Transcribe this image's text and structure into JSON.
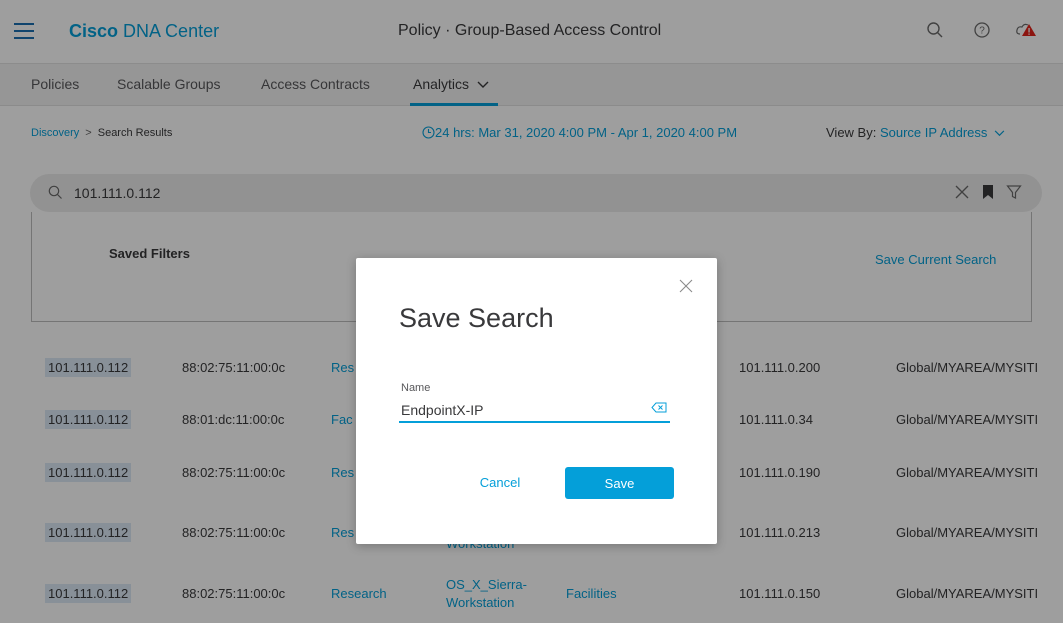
{
  "header": {
    "brand_strong": "Cisco",
    "brand_rest": "DNA Center",
    "title": "Policy · Group-Based Access Control",
    "icons": [
      "search-icon",
      "help-icon",
      "alert-icon"
    ]
  },
  "tabs": [
    {
      "label": "Policies"
    },
    {
      "label": "Scalable Groups"
    },
    {
      "label": "Access Contracts"
    },
    {
      "label": "Analytics"
    }
  ],
  "breadcrumb": {
    "root": "Discovery",
    "separator": ">",
    "current": "Search Results"
  },
  "time_range": "24 hrs:  Mar 31, 2020 4:00 PM - Apr 1, 2020 4:00 PM",
  "view_by": {
    "label": "View By:",
    "value": "Source IP Address"
  },
  "search": {
    "value": "101.111.0.112"
  },
  "filters": {
    "saved_label": "Saved Filters",
    "save_current": "Save Current Search"
  },
  "rows": [
    {
      "ip": "101.111.0.112",
      "mac": "88:02:75:11:00:0c",
      "group": "Res",
      "device": "",
      "dest_group": "",
      "dest_ip": "101.111.0.200",
      "location": "Global/MYAREA/MYSITI"
    },
    {
      "ip": "101.111.0.112",
      "mac": "88:01:dc:11:00:0c",
      "group": "Fac",
      "device": "",
      "dest_group": "",
      "dest_ip": "101.111.0.34",
      "location": "Global/MYAREA/MYSITI"
    },
    {
      "ip": "101.111.0.112",
      "mac": "88:02:75:11:00:0c",
      "group": "Res",
      "device": "",
      "dest_group": "",
      "dest_ip": "101.111.0.190",
      "location": "Global/MYAREA/MYSITI"
    },
    {
      "ip": "101.111.0.112",
      "mac": "88:02:75:11:00:0c",
      "group": "Res",
      "device": "Workstation",
      "dest_group": "",
      "dest_ip": "101.111.0.213",
      "location": "Global/MYAREA/MYSITI"
    },
    {
      "ip": "101.111.0.112",
      "mac": "88:02:75:11:00:0c",
      "group": "Research",
      "device_line1": "OS_X_Sierra-",
      "device_line2": "Workstation",
      "dest_group": "Facilities",
      "dest_ip": "101.111.0.150",
      "location": "Global/MYAREA/MYSITI"
    }
  ],
  "modal": {
    "title": "Save Search",
    "field_label": "Name",
    "field_value": "EndpointX-IP",
    "cancel_label": "Cancel",
    "save_label": "Save"
  },
  "colors": {
    "accent": "#049fd9",
    "highlight": "#dbe8f6",
    "overlay": "rgba(0,0,0,0.38)"
  }
}
